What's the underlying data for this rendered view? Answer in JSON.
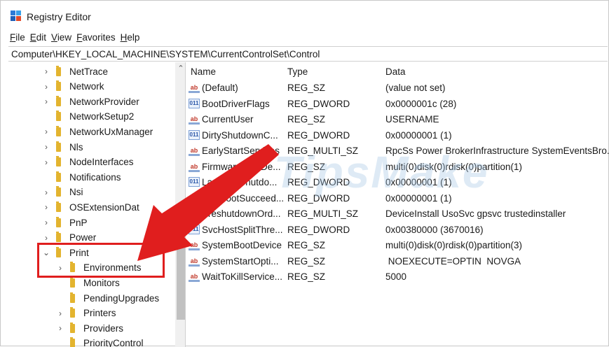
{
  "window": {
    "title": "Registry Editor"
  },
  "menu": [
    {
      "first": "F",
      "rest": "ile"
    },
    {
      "first": "E",
      "rest": "dit"
    },
    {
      "first": "V",
      "rest": "iew"
    },
    {
      "first": "F",
      "rest": "avorites"
    },
    {
      "first": "H",
      "rest": "elp"
    }
  ],
  "address": "Computer\\HKEY_LOCAL_MACHINE\\SYSTEM\\CurrentControlSet\\Control",
  "tree": [
    {
      "label": "NetTrace",
      "chevron": "›"
    },
    {
      "label": "Network",
      "chevron": "›"
    },
    {
      "label": "NetworkProvider",
      "chevron": "›"
    },
    {
      "label": "NetworkSetup2",
      "chevron": ""
    },
    {
      "label": "NetworkUxManager",
      "chevron": "›"
    },
    {
      "label": "Nls",
      "chevron": "›"
    },
    {
      "label": "NodeInterfaces",
      "chevron": "›"
    },
    {
      "label": "Notifications",
      "chevron": ""
    },
    {
      "label": "Nsi",
      "chevron": "›"
    },
    {
      "label": "OSExtensionDat",
      "chevron": "›"
    },
    {
      "label": "PnP",
      "chevron": "›"
    },
    {
      "label": "Power",
      "chevron": "›"
    },
    {
      "label": "Print",
      "chevron": "⌄"
    },
    {
      "label": "Environments",
      "chevron": "›"
    },
    {
      "label": "Monitors",
      "chevron": ""
    },
    {
      "label": "PendingUpgrades",
      "chevron": ""
    },
    {
      "label": "Printers",
      "chevron": "›"
    },
    {
      "label": "Providers",
      "chevron": "›"
    },
    {
      "label": "PriorityControl",
      "chevron": ""
    }
  ],
  "columns": {
    "name": "Name",
    "type": "Type",
    "data": "Data"
  },
  "values": [
    {
      "name": "(Default)",
      "type": "REG_SZ",
      "data": "(value not set)",
      "icon": "ab"
    },
    {
      "name": "BootDriverFlags",
      "type": "REG_DWORD",
      "data": "0x0000001c (28)",
      "icon": "011"
    },
    {
      "name": "CurrentUser",
      "type": "REG_SZ",
      "data": "USERNAME",
      "icon": "ab"
    },
    {
      "name": "DirtyShutdownC...",
      "type": "REG_DWORD",
      "data": "0x00000001 (1)",
      "icon": "011"
    },
    {
      "name": "EarlyStartServices",
      "type": "REG_MULTI_SZ",
      "data": "RpcSs Power BrokerInfrastructure SystemEventsBro...",
      "icon": "ab"
    },
    {
      "name": "FirmwareBootDe...",
      "type": "REG_SZ",
      "data": "multi(0)disk(0)rdisk(0)partition(1)",
      "icon": "ab"
    },
    {
      "name": "LastBootShutdo...",
      "type": "REG_DWORD",
      "data": "0x00000001 (1)",
      "icon": "011"
    },
    {
      "name": "LastBootSucceed...",
      "type": "REG_DWORD",
      "data": "0x00000001 (1)",
      "icon": "ab"
    },
    {
      "name": "PreshutdownOrd...",
      "type": "REG_MULTI_SZ",
      "data": "DeviceInstall UsoSvc gpsvc trustedinstaller",
      "icon": "ab"
    },
    {
      "name": "SvcHostSplitThre...",
      "type": "REG_DWORD",
      "data": "0x00380000 (3670016)",
      "icon": "011"
    },
    {
      "name": "SystemBootDevice",
      "type": "REG_SZ",
      "data": "multi(0)disk(0)rdisk(0)partition(3)",
      "icon": "ab"
    },
    {
      "name": "SystemStartOpti...",
      "type": "REG_SZ",
      "data": " NOEXECUTE=OPTIN  NOVGA",
      "icon": "ab"
    },
    {
      "name": "WaitToKillService...",
      "type": "REG_SZ",
      "data": "5000",
      "icon": "ab"
    }
  ],
  "watermark": "TipsMake",
  "colors": {
    "highlight_box": "#e01e1e",
    "arrow": "#e01e1e",
    "folder": "#e3b42f"
  }
}
